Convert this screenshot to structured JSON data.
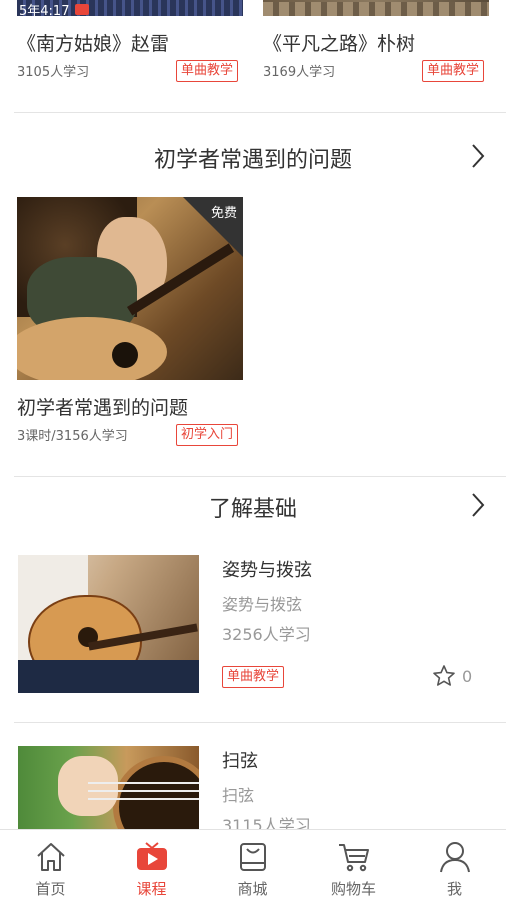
{
  "top_courses": [
    {
      "title": "《南方姑娘》赵雷",
      "learners": "3105人学习",
      "tag": "单曲教学"
    },
    {
      "title": "《平凡之路》朴树",
      "learners": "3169人学习",
      "tag": "单曲教学"
    }
  ],
  "sections": [
    {
      "title": "初学者常遇到的问题",
      "course": {
        "badge": "免费",
        "title": "初学者常遇到的问题",
        "meta": "3课时/3156人学习",
        "tag": "初学入门"
      }
    },
    {
      "title": "了解基础",
      "items": [
        {
          "title": "姿势与拨弦",
          "subtitle": "姿势与拨弦",
          "learners": "3256人学习",
          "tag": "单曲教学",
          "likes": "0"
        },
        {
          "title": "扫弦",
          "subtitle": "扫弦",
          "learners": "3115人学习"
        }
      ]
    }
  ],
  "tabs": [
    {
      "label": "首页",
      "icon": "home-icon"
    },
    {
      "label": "课程",
      "icon": "course-tv-icon",
      "active": true
    },
    {
      "label": "商城",
      "icon": "store-icon"
    },
    {
      "label": "购物车",
      "icon": "cart-icon"
    },
    {
      "label": "我",
      "icon": "profile-icon"
    }
  ],
  "colors": {
    "accent": "#e8463a",
    "divider": "#e4e4e4",
    "text": "#333333",
    "muted": "#666666"
  }
}
